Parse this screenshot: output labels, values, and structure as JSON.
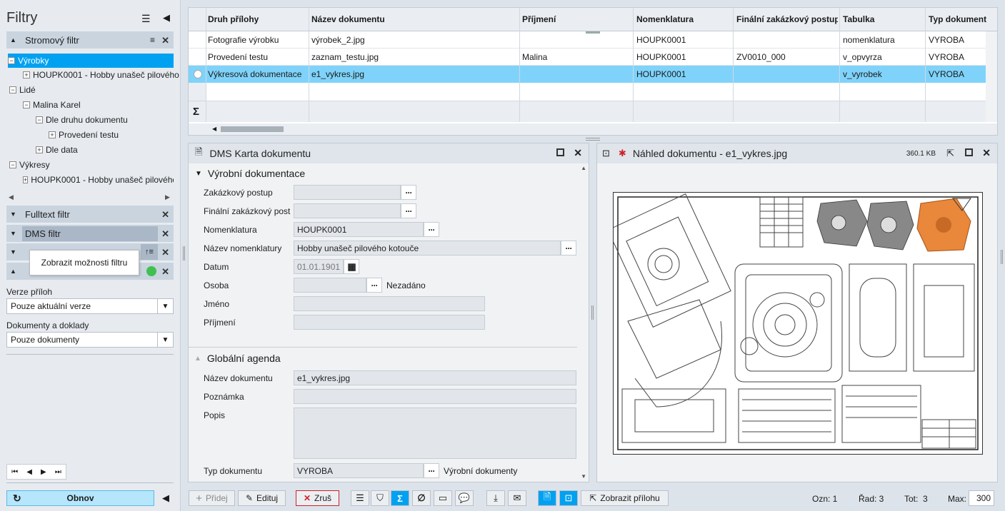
{
  "left": {
    "title": "Filtry",
    "tree_filter": {
      "label": "Stromový filtr"
    },
    "tree": {
      "item0": "Výrobky",
      "item1": "HOUPK0001 - Hobby unašeč pilového",
      "item2": "Lidé",
      "item3": "Malina Karel",
      "item4": "Dle druhu dokumentu",
      "item5": "Provedení testu",
      "item6": "Dle data",
      "item7": "Výkresy",
      "item8": "HOUPK0001 - Hobby unašeč pilového"
    },
    "fulltext_filter": "Fulltext filtr",
    "dms_filter": "DMS filtr",
    "tooltip": "Zobrazit možnosti filtru",
    "versions_label": "Verze příloh",
    "versions_value": "Pouze aktuální verze",
    "docs_label": "Dokumenty a doklady",
    "docs_value": "Pouze dokumenty",
    "refresh": "Obnov"
  },
  "grid": {
    "columns": [
      "Druh přílohy",
      "Název dokumentu",
      "Příjmení",
      "Nomenklatura",
      "Finální zakázkový postup",
      "Tabulka",
      "Typ dokument"
    ],
    "rows": [
      [
        "Fotografie výrobku",
        "výrobek_2.jpg",
        "",
        "HOUPK0001",
        "",
        "nomenklatura",
        "VYROBA"
      ],
      [
        "Provedení testu",
        "zaznam_testu.jpg",
        "Malina",
        "HOUPK0001",
        "ZV0010_000",
        "v_opvyrza",
        "VYROBA"
      ],
      [
        "Výkresová dokumentace",
        "e1_vykres.jpg",
        "",
        "HOUPK0001",
        "",
        "v_vyrobek",
        "VYROBA"
      ]
    ],
    "sum_symbol": "Σ"
  },
  "card": {
    "title": "DMS Karta dokumentu",
    "section1": "Výrobní dokumentace",
    "labels": {
      "zak_postup": "Zakázkový postup",
      "fin_postup": "Finální zakázkový post",
      "nomenklatura": "Nomenklatura",
      "nazev_nom": "Název nomenklatury",
      "datum": "Datum",
      "osoba": "Osoba",
      "jmeno": "Jméno",
      "prijmeni": "Příjmení"
    },
    "values": {
      "nomenklatura": "HOUPK0001",
      "nazev_nom": "Hobby unašeč pilového kotouče",
      "datum": "01.01.1901",
      "osoba_note": "Nezadáno"
    },
    "section2": "Globální agenda",
    "labels2": {
      "nazev_dok": "Název dokumentu",
      "poznamka": "Poznámka",
      "popis": "Popis",
      "typ_dok": "Typ dokumentu"
    },
    "values2": {
      "nazev_dok": "e1_vykres.jpg",
      "typ_dok": "VYROBA",
      "typ_note": "Výrobní dokumenty"
    }
  },
  "preview": {
    "title": "Náhled dokumentu - e1_vykres.jpg",
    "size": "360.1 KB"
  },
  "toolbar": {
    "add": "Přidej",
    "edit": "Edituj",
    "cancel": "Zruš",
    "show_attachment": "Zobrazit přílohu"
  },
  "status": {
    "ozn": "Ozn: 1",
    "rad": "Řad: 3",
    "tot": "Tot:  3",
    "max_label": "Max:",
    "max_value": "300"
  },
  "colors": {
    "accent": "#00a1f1",
    "selected_row": "#7fd3fa"
  }
}
